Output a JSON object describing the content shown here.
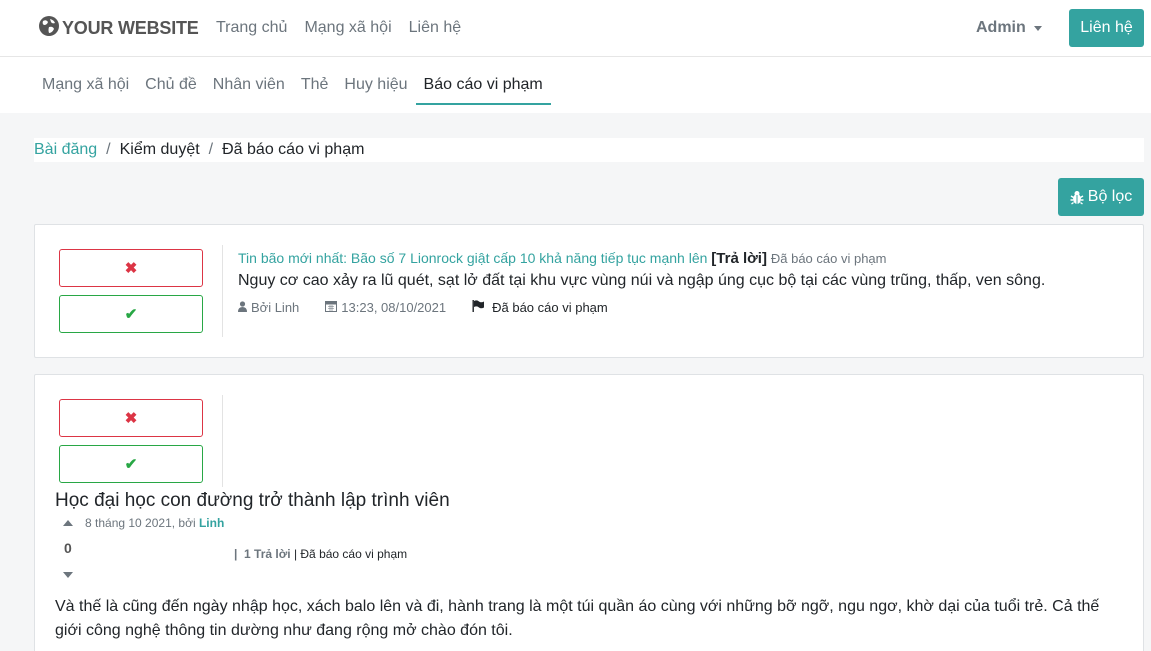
{
  "header": {
    "logo_text": "YOUR WEBSITE",
    "nav": [
      "Trang chủ",
      "Mạng xã hội",
      "Liên hệ"
    ],
    "user": "Admin",
    "contact_label": "Liên hệ"
  },
  "subnav": {
    "items": [
      "Mạng xã hội",
      "Chủ đề",
      "Nhân viên",
      "Thẻ",
      "Huy hiệu",
      "Báo cáo vi phạm"
    ],
    "active": "Báo cáo vi phạm"
  },
  "breadcrumb": {
    "items": [
      "Bài đăng",
      "Kiểm duyệt",
      "Đã báo cáo vi phạm"
    ]
  },
  "filter_label": "Bộ lọc",
  "actions": {
    "reject": "✖",
    "approve": "✔"
  },
  "posts": [
    {
      "title": "Tin bão mới nhất: Bão số 7 Lionrock giật cấp 10 khả năng tiếp tục mạnh lên",
      "reply_tag": "[Trả lời]",
      "status": "Đã báo cáo vi phạm",
      "body": "Nguy cơ cao xảy ra lũ quét, sạt lở đất tại khu vực vùng núi và ngập úng cục bộ tại các vùng trũng, thấp, ven sông.",
      "author": "Bởi Linh",
      "datetime": "13:23, 08/10/2021",
      "flag_label": "Đã báo cáo vi phạm"
    }
  ],
  "question": {
    "title": "Học đại học con đường trở thành lập trình viên",
    "date_prefix": "8 tháng 10 2021, bởi",
    "author": "Linh",
    "votes": "0",
    "separator": "|",
    "reply_count": "1 Trả lời",
    "status": "| Đã báo cáo vi phạm",
    "body": "Và thế là cũng đến ngày nhập học, xách balo lên và đi, hành trang là một túi quần áo cùng với những bỡ ngỡ, ngu ngơ, khờ dại của tuổi trẻ. Cả thế giới công nghệ thông tin dường như đang rộng mở chào đón tôi."
  },
  "colors": {
    "accent": "#34a3a0",
    "danger": "#dc3545",
    "success": "#28a745"
  }
}
